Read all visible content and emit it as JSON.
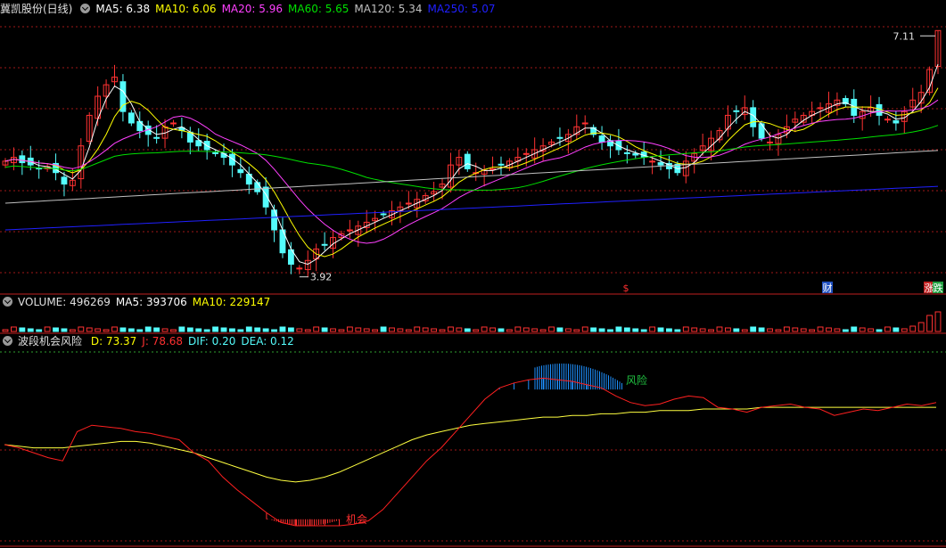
{
  "colors": {
    "up": "#ff3232",
    "down": "#54fcfc",
    "ma5": "#ffffff",
    "ma10": "#ffff00",
    "ma20": "#ff40ff",
    "ma60": "#00e000",
    "ma120": "#c0c0c0",
    "ma250": "#2020ff",
    "grid": "#a01818",
    "kline_d": "#ff2020",
    "kline_dea": "#ffff40",
    "risk": "#1e90ff",
    "opp": "#ff3030"
  },
  "price_panel": {
    "title": "冀凯股份(日线)",
    "legend": [
      {
        "label": "MA5: 6.38",
        "color": "#ffffff"
      },
      {
        "label": "MA10: 6.06",
        "color": "#ffff00"
      },
      {
        "label": "MA20: 5.96",
        "color": "#ff40ff"
      },
      {
        "label": "MA60: 5.65",
        "color": "#00e000"
      },
      {
        "label": "MA120: 5.34",
        "color": "#c0c0c0"
      },
      {
        "label": "MA250: 5.07",
        "color": "#2020ff"
      }
    ],
    "high_label": "7.11",
    "low_label": "3.92",
    "markers": [
      {
        "text": "$",
        "color": "#ff3030",
        "bg": ""
      },
      {
        "text": "财",
        "color": "#ffffff",
        "bg": "#2050c0"
      },
      {
        "text": "涨",
        "color": "#ffffff",
        "bg": "#c02020"
      },
      {
        "text": "跌",
        "color": "#ffffff",
        "bg": "#20a040"
      }
    ]
  },
  "volume_panel": {
    "legend": [
      {
        "label": "VOLUME: 496269",
        "color": "#e0e0e0"
      },
      {
        "label": "MA5: 393706",
        "color": "#ffffff"
      },
      {
        "label": "MA10: 229147",
        "color": "#ffff00"
      }
    ]
  },
  "indicator_panel": {
    "title": "波段机会风险",
    "legend": [
      {
        "label": "D: 73.37",
        "color": "#ffff00"
      },
      {
        "label": "J: 78.68",
        "color": "#ff3030"
      },
      {
        "label": "DIF: 0.20",
        "color": "#54fcfc"
      },
      {
        "label": "DEA: 0.12",
        "color": "#54fcfc"
      }
    ],
    "risk_label": "风险",
    "opportunity_label": "机会"
  },
  "chart_data": [
    {
      "type": "candlestick",
      "title": "冀凯股份(日线)",
      "low": 3.92,
      "high": 7.11,
      "ylim": [
        3.8,
        7.3
      ],
      "last": {
        "ma5": 6.38,
        "ma10": 6.06,
        "ma20": 5.96,
        "ma60": 5.65,
        "ma120": 5.34,
        "ma250": 5.07
      },
      "close": [
        5.4,
        5.45,
        5.38,
        5.35,
        5.3,
        5.33,
        5.25,
        5.1,
        5.15,
        5.6,
        6.0,
        6.25,
        6.4,
        6.5,
        6.05,
        5.9,
        5.8,
        5.75,
        5.7,
        5.85,
        5.9,
        5.8,
        5.65,
        5.6,
        5.55,
        5.5,
        5.45,
        5.35,
        5.25,
        5.1,
        5.0,
        4.8,
        4.5,
        4.2,
        4.05,
        4.0,
        4.1,
        4.25,
        4.3,
        4.4,
        4.45,
        4.5,
        4.55,
        4.6,
        4.65,
        4.7,
        4.75,
        4.8,
        4.85,
        4.9,
        4.95,
        5.0,
        5.1,
        5.35,
        5.45,
        5.3,
        5.25,
        5.28,
        5.3,
        5.35,
        5.4,
        5.45,
        5.5,
        5.55,
        5.6,
        5.65,
        5.7,
        5.75,
        5.85,
        5.9,
        5.75,
        5.65,
        5.6,
        5.55,
        5.5,
        5.48,
        5.45,
        5.4,
        5.35,
        5.3,
        5.25,
        5.4,
        5.5,
        5.6,
        5.7,
        5.8,
        6.0,
        6.05,
        6.1,
        5.85,
        5.7,
        5.65,
        5.75,
        5.85,
        5.95,
        6.0,
        6.05,
        6.1,
        6.15,
        6.2,
        6.15,
        6.0,
        6.05,
        6.1,
        6.0,
        5.95,
        5.9,
        6.05,
        6.2,
        6.3,
        6.6,
        7.11
      ]
    },
    {
      "type": "bar",
      "title": "VOLUME",
      "last": {
        "volume": 496269,
        "ma5": 393706,
        "ma10": 229147
      }
    },
    {
      "type": "line",
      "title": "波段机会风险",
      "last": {
        "D": 73.37,
        "J": 78.68,
        "DIF": 0.2,
        "DEA": 0.12
      },
      "series": [
        {
          "name": "J",
          "values": [
            50,
            48,
            45,
            42,
            40,
            58,
            62,
            61,
            60,
            58,
            57,
            55,
            53,
            45,
            40,
            30,
            22,
            15,
            8,
            2,
            0,
            0,
            0,
            0,
            1,
            3,
            10,
            20,
            30,
            40,
            48,
            58,
            68,
            78,
            85,
            88,
            90,
            91,
            90,
            89,
            87,
            85,
            80,
            76,
            74,
            75,
            78,
            80,
            79,
            73,
            72,
            70,
            73,
            74,
            75,
            73,
            72,
            68,
            70,
            72,
            71,
            73,
            75,
            74,
            76
          ]
        },
        {
          "name": "D",
          "values": [
            50,
            49,
            48,
            48,
            48,
            49,
            50,
            51,
            52,
            52,
            51,
            49,
            47,
            45,
            42,
            39,
            36,
            33,
            30,
            28,
            27,
            28,
            30,
            33,
            37,
            41,
            45,
            49,
            53,
            56,
            58,
            60,
            62,
            63,
            64,
            65,
            66,
            67,
            67,
            68,
            68,
            69,
            69,
            70,
            70,
            71,
            71,
            71,
            72,
            72,
            72,
            72,
            73,
            73,
            73,
            73,
            73,
            73,
            73,
            73,
            73,
            73,
            73,
            73,
            73
          ]
        }
      ],
      "risk_label": "风险",
      "opportunity_label": "机会"
    }
  ]
}
